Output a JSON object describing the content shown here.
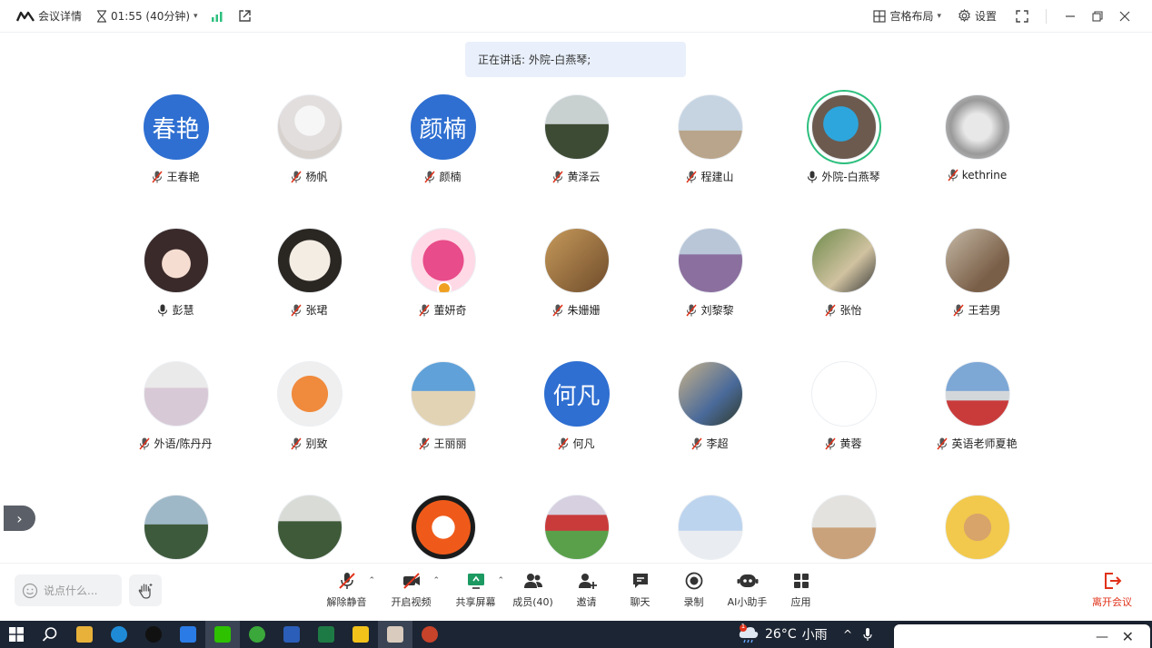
{
  "topbar": {
    "meeting_details": "会议详情",
    "timer": "01:55 (40分钟)",
    "layout_label": "宫格布局",
    "settings_label": "设置"
  },
  "speaking": {
    "text": "正在讲话: 外院-白燕琴;"
  },
  "participants": [
    {
      "name": "王春艳",
      "avatar_text": "春艳",
      "mic": "muted"
    },
    {
      "name": "杨帆",
      "mic": "muted"
    },
    {
      "name": "颜楠",
      "avatar_text": "颜楠",
      "mic": "muted"
    },
    {
      "name": "黄泽云",
      "mic": "muted"
    },
    {
      "name": "程建山",
      "mic": "muted"
    },
    {
      "name": "外院-白燕琴",
      "mic": "on",
      "speaking": true
    },
    {
      "name": "kethrine",
      "mic": "muted"
    },
    {
      "name": "彭慧",
      "mic": "on"
    },
    {
      "name": "张珺",
      "mic": "muted"
    },
    {
      "name": "董妍奇",
      "mic": "muted",
      "host_badge": true
    },
    {
      "name": "朱姗姗",
      "mic": "muted"
    },
    {
      "name": "刘黎黎",
      "mic": "muted"
    },
    {
      "name": "张怡",
      "mic": "muted"
    },
    {
      "name": "王若男",
      "mic": "muted"
    },
    {
      "name": "外语/陈丹丹",
      "mic": "muted"
    },
    {
      "name": "别致",
      "mic": "muted"
    },
    {
      "name": "王丽丽",
      "mic": "muted"
    },
    {
      "name": "何凡",
      "avatar_text": "何凡",
      "mic": "muted"
    },
    {
      "name": "李超",
      "mic": "muted"
    },
    {
      "name": "黄蓉",
      "mic": "muted"
    },
    {
      "name": "英语老师夏艳",
      "mic": "muted"
    },
    {
      "name": "",
      "mic": "none"
    },
    {
      "name": "",
      "mic": "none"
    },
    {
      "name": "",
      "mic": "none"
    },
    {
      "name": "",
      "mic": "none"
    },
    {
      "name": "",
      "mic": "none"
    },
    {
      "name": "",
      "mic": "none"
    },
    {
      "name": "",
      "mic": "none"
    }
  ],
  "chat": {
    "placeholder": "说点什么..."
  },
  "toolbar": {
    "unmute": "解除静音",
    "start_video": "开启视频",
    "share_screen": "共享屏幕",
    "members": "成员(40)",
    "invite": "邀请",
    "chat": "聊天",
    "record": "录制",
    "ai_assistant": "AI小助手",
    "apps": "应用",
    "leave": "离开会议"
  },
  "taskbar": {
    "temperature": "26°C",
    "weather": "小雨",
    "notification_count": "1"
  },
  "colors": {
    "accent_blue": "#2f6fd1",
    "speaking_green": "#2dbf7e",
    "leave_red": "#e0321a",
    "muted_red": "#e0321a"
  }
}
